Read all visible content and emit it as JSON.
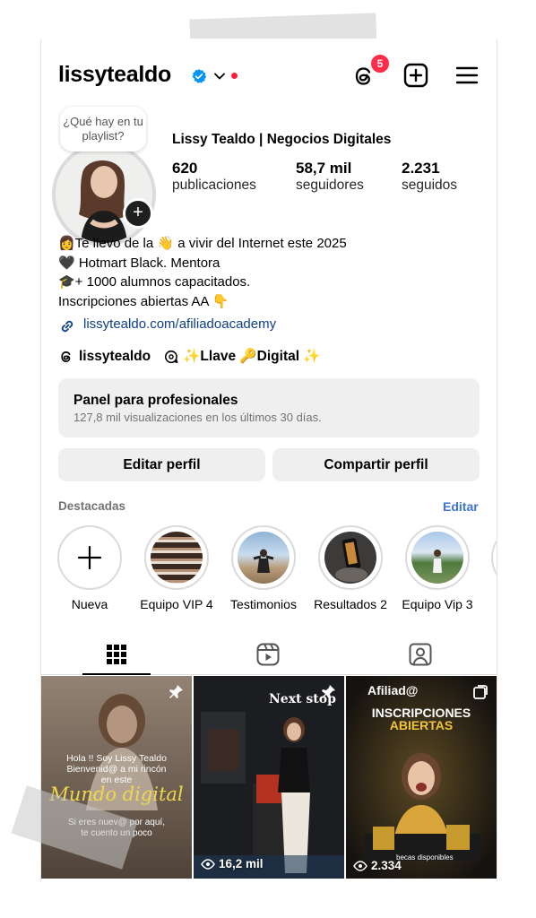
{
  "header": {
    "username": "lissytealdo",
    "notification_count": "5"
  },
  "profile": {
    "note_bubble": "¿Qué hay en tu playlist?",
    "full_name": "Lissy Tealdo | Negocios Digitales",
    "stats": [
      {
        "value": "620",
        "label": "publicaciones"
      },
      {
        "value": "58,7 mil",
        "label": "seguidores"
      },
      {
        "value": "2.231",
        "label": "seguidos"
      }
    ],
    "bio": [
      "👩Te llevo de la 👋 a vivir del Internet este 2025",
      "🖤 Hotmart Black. Mentora",
      "🎓+ 1000 alumnos capacitados.",
      "Inscripciones abiertas AA 👇"
    ],
    "link": "lissytealdo.com/afiliadoacademy",
    "threads_handle": "lissytealdo",
    "channel_name": "✨Llave 🔑Digital ✨"
  },
  "dashboard": {
    "title": "Panel para profesionales",
    "subtitle": "127,8 mil visualizaciones en los últimos 30 días."
  },
  "buttons": {
    "edit_profile": "Editar perfil",
    "share_profile": "Compartir perfil"
  },
  "highlights": {
    "section_title": "Destacadas",
    "edit_label": "Editar",
    "items": [
      {
        "label": "Nueva"
      },
      {
        "label": "Equipo VIP 4"
      },
      {
        "label": "Testimonios"
      },
      {
        "label": "Resultados 2"
      },
      {
        "label": "Equipo Vip 3"
      }
    ]
  },
  "posts": [
    {
      "overlay_lines": [
        "Hola !! Soy Lissy Tealdo",
        "Bienvenid@ a mi rincón",
        "en este"
      ],
      "script_text": "Mundo digital",
      "footer_lines": [
        "Si eres nuev@ por aquí,",
        "te cuento un poco"
      ],
      "pinned": true
    },
    {
      "overlay_title": "Next stop",
      "views": "16,2 mil",
      "pinned": true
    },
    {
      "brand": "Afiliad@",
      "headline": [
        "INSCRIPCIONES",
        "ABIERTAS"
      ],
      "footer": "becas disponibles",
      "views": "2.334"
    }
  ],
  "colors": {
    "accent": "#3d74d6",
    "badge": "#ff2d4a",
    "link": "#0d3e8a",
    "verified": "#0095f6"
  }
}
